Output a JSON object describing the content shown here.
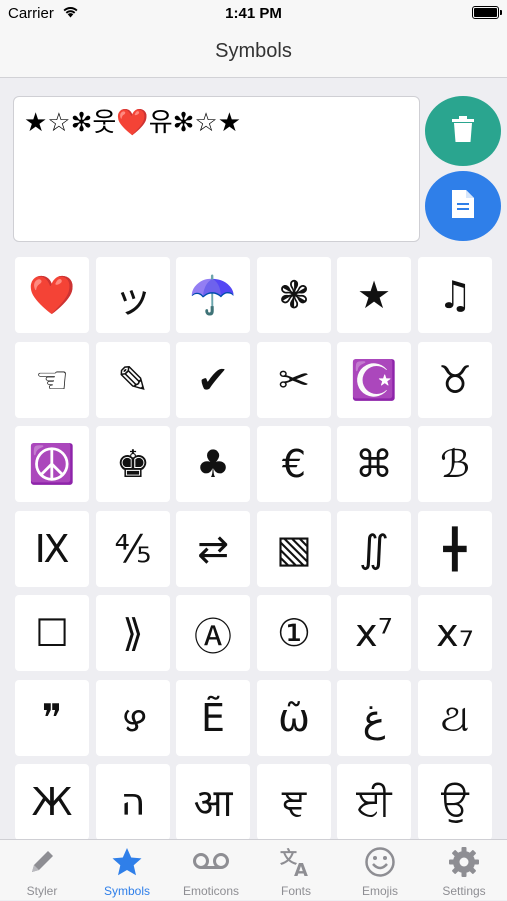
{
  "status_bar": {
    "carrier": "Carrier",
    "time": "1:41 PM"
  },
  "nav": {
    "title": "Symbols"
  },
  "editor": {
    "text": "★☆✻웃❤️유✻☆★"
  },
  "actions": {
    "delete_icon": "trash-icon",
    "copy_icon": "document-icon",
    "delete_color": "#2aa58f",
    "copy_color": "#2f7fe9"
  },
  "symbols": [
    "❤️",
    "ッ",
    "☂️",
    "❃",
    "★",
    "♫",
    "☜",
    "✎",
    "✔",
    "✂",
    "☪️",
    "♉",
    "☮️",
    "♚",
    "♣",
    "€",
    "⌘",
    "ℬ",
    "Ⅸ",
    "⅘",
    "⇄",
    "▧",
    "∬",
    "╋",
    "☐",
    "⟫",
    "Ⓐ",
    "①",
    "x⁷",
    "x₇",
    "❞",
    "ഴ",
    "Ẽ",
    "ῶ",
    "غ",
    "ଥ",
    "Ж",
    "ה",
    "आ",
    "ਞ",
    "ਈ",
    "ਉ"
  ],
  "tabs": [
    {
      "label": "Styler",
      "icon": "pencil-icon"
    },
    {
      "label": "Symbols",
      "icon": "star-icon",
      "active": true
    },
    {
      "label": "Emoticons",
      "icon": "voicemail-icon"
    },
    {
      "label": "Fonts",
      "icon": "translate-icon"
    },
    {
      "label": "Emojis",
      "icon": "smiley-icon"
    },
    {
      "label": "Settings",
      "icon": "gear-icon"
    }
  ],
  "accent_color": "#2f7fe9"
}
